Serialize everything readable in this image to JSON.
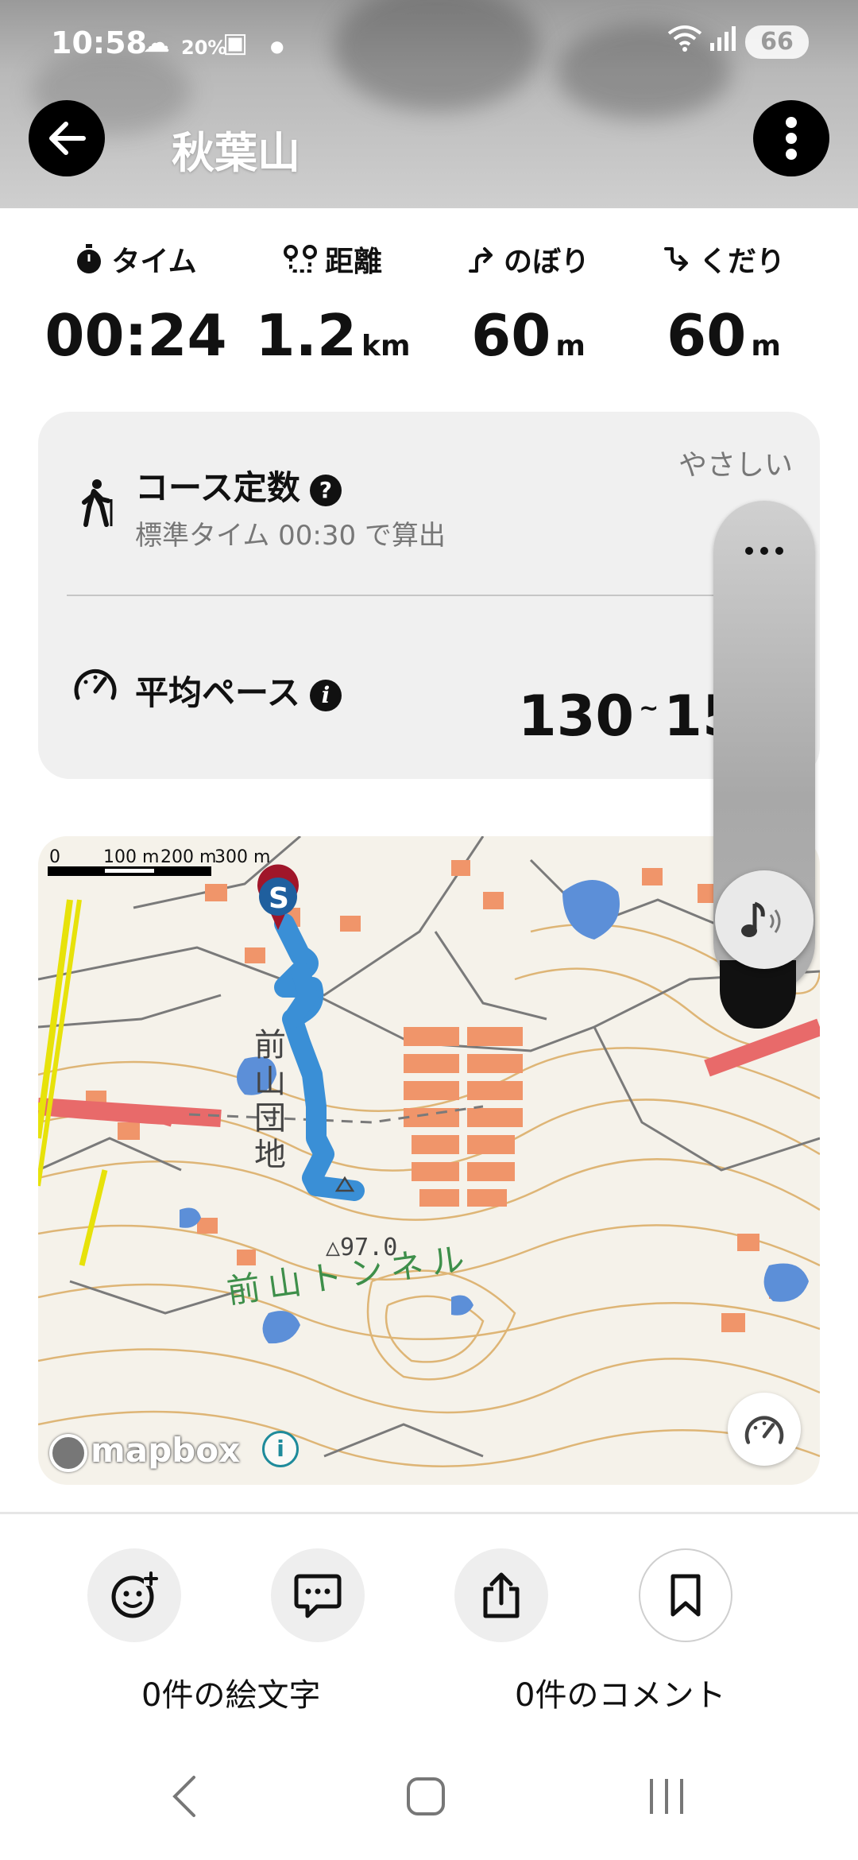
{
  "status_bar": {
    "time": "10:58",
    "rain_percent": "20%",
    "battery": "66"
  },
  "header": {
    "title": "秋葉山"
  },
  "stats": [
    {
      "label": "タイム",
      "icon": "stopwatch-icon",
      "value": "00:24",
      "unit": ""
    },
    {
      "label": "距離",
      "icon": "route-icon",
      "value": "1.2",
      "unit": "km"
    },
    {
      "label": "のぼり",
      "icon": "ascent-icon",
      "value": "60",
      "unit": "m"
    },
    {
      "label": "くだり",
      "icon": "descent-icon",
      "value": "60",
      "unit": "m"
    }
  ],
  "course": {
    "constant_label": "コース定数",
    "difficulty": "やさしい",
    "standard_time_text": "標準タイム 00:30 で算出",
    "pace_label": "平均ペース",
    "pace_value_low": "130",
    "pace_tilde": "~",
    "pace_value_high": "15"
  },
  "map": {
    "scale_labels": [
      "0",
      "100 m",
      "200 m",
      "300 m"
    ],
    "start_marker": "S",
    "place_labels": [
      "前",
      "山",
      "団",
      "地"
    ],
    "tunnel_label": "前山トンネル",
    "elevation_label": "△97.0",
    "attribution": "mapbox",
    "info_glyph": "i"
  },
  "actions": {
    "emoji_count_label": "0件の絵文字",
    "comment_count_label": "0件のコメント"
  },
  "colors": {
    "route": "#3a8fd6",
    "start_marker": "#1f5f9e",
    "start_pin": "#a0162a",
    "road": "#e86a6a"
  }
}
